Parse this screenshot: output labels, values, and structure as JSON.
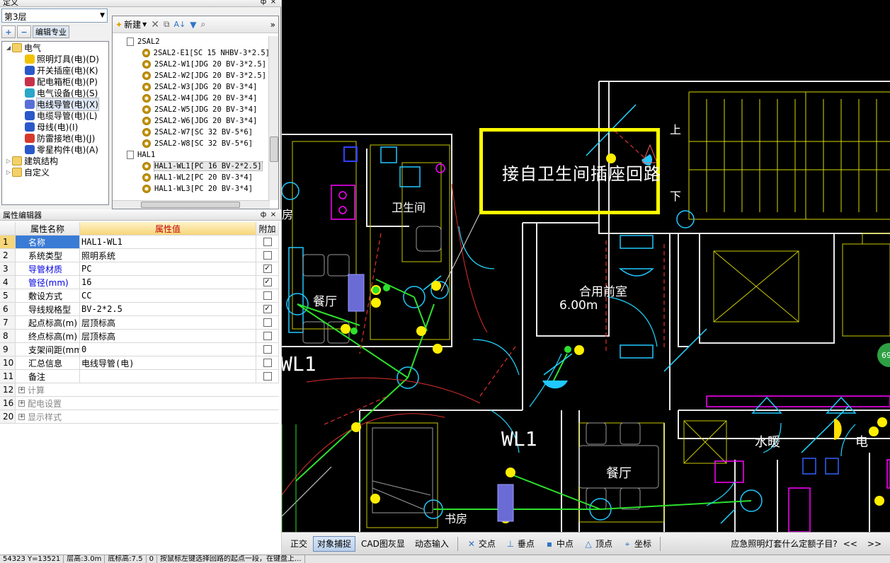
{
  "def_panel": {
    "title": "定义",
    "pin": "ф",
    "close": "×"
  },
  "floor": {
    "value": "第3层"
  },
  "def_tabs": {
    "add": "+",
    "remove": "−",
    "edit_label": "编辑专业"
  },
  "tree": [
    {
      "label": "电气",
      "level": 0,
      "expanded": true,
      "icon": "folder-icon"
    },
    {
      "label": "照明灯具(电)(D)",
      "level": 1,
      "icon": "bulb-icon",
      "color": "#f2c200"
    },
    {
      "label": "开关插座(电)(K)",
      "level": 1,
      "icon": "switch-icon",
      "color": "#2a58c9"
    },
    {
      "label": "配电箱柜(电)(P)",
      "level": 1,
      "icon": "panel-icon",
      "color": "#c8304a"
    },
    {
      "label": "电气设备(电)(S)",
      "level": 1,
      "icon": "device-icon",
      "color": "#2aa7c9"
    },
    {
      "label": "电线导管(电)(X)",
      "level": 1,
      "icon": "conduit-icon",
      "color": "#5a6fd6",
      "selected": true
    },
    {
      "label": "电缆导管(电)(L)",
      "level": 1,
      "icon": "cable-icon",
      "color": "#2a58c9"
    },
    {
      "label": "母线(电)(I)",
      "level": 1,
      "icon": "busbar-icon",
      "color": "#2a58c9"
    },
    {
      "label": "防雷接地(电)(J)",
      "level": 1,
      "icon": "lightning-icon",
      "color": "#d63a2a"
    },
    {
      "label": "零星构件(电)(A)",
      "level": 1,
      "icon": "misc-icon",
      "color": "#2a58c9"
    },
    {
      "label": "建筑结构",
      "level": 0,
      "expanded": false,
      "icon": "folder-icon"
    },
    {
      "label": "自定义",
      "level": 0,
      "expanded": false,
      "icon": "folder-icon"
    }
  ],
  "list_toolbar": {
    "new_label": "新建",
    "more": "»"
  },
  "list": [
    {
      "label": "2SAL2",
      "group": true
    },
    {
      "label": "2SAL2-E1[SC 15 NHBV-3*2.5]"
    },
    {
      "label": "2SAL2-W1[JDG 20 BV-3*2.5]"
    },
    {
      "label": "2SAL2-W2[JDG 20 BV-3*2.5]"
    },
    {
      "label": "2SAL2-W3[JDG 20 BV-3*4]"
    },
    {
      "label": "2SAL2-W4[JDG 20 BV-3*4]"
    },
    {
      "label": "2SAL2-W5[JDG 20 BV-3*4]"
    },
    {
      "label": "2SAL2-W6[JDG 20 BV-3*4]"
    },
    {
      "label": "2SAL2-W7[SC 32 BV-5*6]"
    },
    {
      "label": "2SAL2-W8[SC 32 BV-5*6]"
    },
    {
      "label": "HAL1",
      "group": true
    },
    {
      "label": "HAL1-WL1[PC 16 BV-2*2.5]",
      "selected": true
    },
    {
      "label": "HAL1-WL2[PC 20 BV-3*4]"
    },
    {
      "label": "HAL1-WL3[PC 20 BV-3*4]"
    }
  ],
  "prop_panel": {
    "title": "属性编辑器",
    "pin": "ф",
    "close": "×"
  },
  "prop_headers": {
    "name": "属性名称",
    "value": "属性值",
    "extra": "附加"
  },
  "props": [
    {
      "no": "1",
      "name": "名称",
      "value": "HAL1-WL1",
      "blue": true,
      "check": false,
      "selected": true
    },
    {
      "no": "2",
      "name": "系统类型",
      "value": "照明系统",
      "blue": false,
      "check": false
    },
    {
      "no": "3",
      "name": "导管材质",
      "value": "PC",
      "blue": true,
      "check": true
    },
    {
      "no": "4",
      "name": "管径(mm)",
      "value": "16",
      "blue": true,
      "check": true
    },
    {
      "no": "5",
      "name": "敷设方式",
      "value": "CC",
      "blue": false,
      "check": false
    },
    {
      "no": "6",
      "name": "导线规格型",
      "value": "BV-2*2.5",
      "blue": false,
      "check": true
    },
    {
      "no": "7",
      "name": "起点标高(m)",
      "value": "层顶标高",
      "blue": false,
      "check": false
    },
    {
      "no": "8",
      "name": "终点标高(m)",
      "value": "层顶标高",
      "blue": false,
      "check": false
    },
    {
      "no": "9",
      "name": "支架间距(mm",
      "value": "0",
      "blue": false,
      "check": false
    },
    {
      "no": "10",
      "name": "汇总信息",
      "value": "电线导管(电)",
      "blue": false,
      "check": false
    },
    {
      "no": "11",
      "name": "备注",
      "value": "",
      "blue": false,
      "check": false
    }
  ],
  "prop_groups": [
    {
      "no": "12",
      "name": "计算"
    },
    {
      "no": "16",
      "name": "配电设置"
    },
    {
      "no": "20",
      "name": "显示样式"
    }
  ],
  "cad": {
    "callout": "接自卫生间插座回路",
    "rooms": [
      {
        "text": "卫生间",
        "key": "bath"
      },
      {
        "text": "餐厅",
        "key": "dining1"
      },
      {
        "text": "合用前室",
        "key": "lobby"
      },
      {
        "text": "6.00m",
        "key": "elev"
      },
      {
        "text": "WL1",
        "key": "wl1a"
      },
      {
        "text": "WL1",
        "key": "wl1b"
      },
      {
        "text": "餐厅",
        "key": "dining2"
      },
      {
        "text": "水暖",
        "key": "hvac"
      },
      {
        "text": "电",
        "key": "elec"
      },
      {
        "text": "书房",
        "key": "study"
      },
      {
        "text": "房",
        "key": "room"
      },
      {
        "text": "上",
        "key": "up"
      },
      {
        "text": "下",
        "key": "down"
      }
    ],
    "badge": "69"
  },
  "status": {
    "buttons": [
      {
        "label": "正交",
        "on": false
      },
      {
        "label": "对象捕捉",
        "on": true
      },
      {
        "label": "CAD图灰显",
        "on": false
      },
      {
        "label": "动态输入",
        "on": false
      }
    ],
    "snaps": [
      {
        "label": "交点",
        "icon": "intersection-icon"
      },
      {
        "label": "垂点",
        "icon": "perpendicular-icon"
      },
      {
        "label": "中点",
        "icon": "midpoint-icon"
      },
      {
        "label": "顶点",
        "icon": "vertex-icon"
      },
      {
        "label": "坐标",
        "icon": "coordinate-icon"
      }
    ],
    "hint": "应急照明灯套什么定额子目?",
    "prev": "<<",
    "next": ">>"
  },
  "bottom": [
    "54323 Y=13521",
    "层高:3.0m",
    "底标高:7.5",
    "0",
    "按鼠标左键选择回路的起点一段，在键盘上..."
  ]
}
